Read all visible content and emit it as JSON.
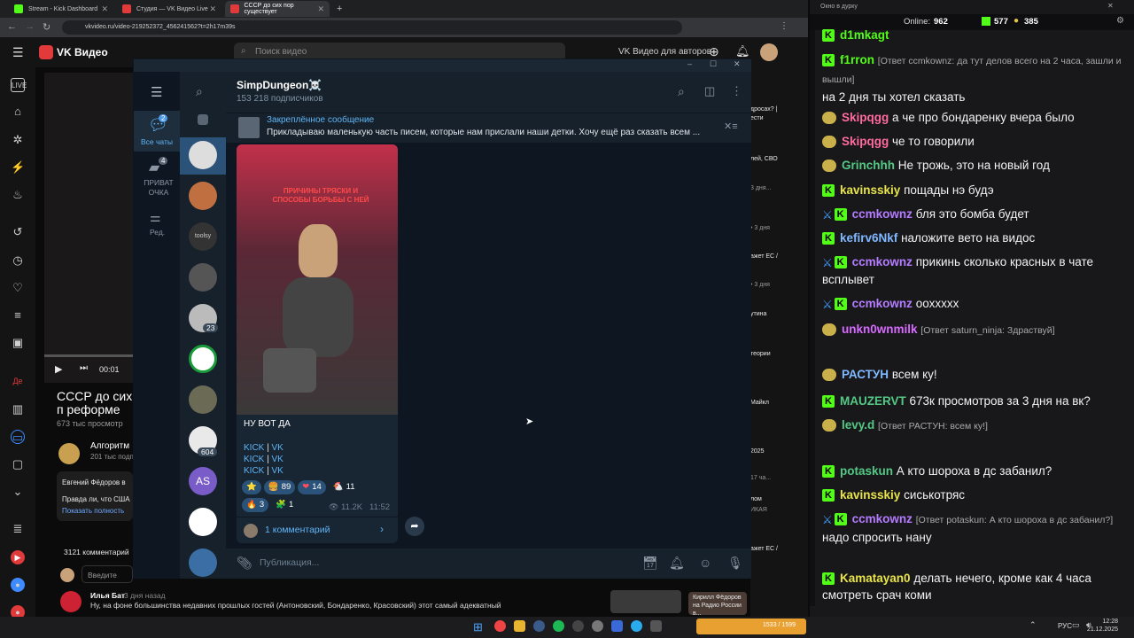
{
  "browser": {
    "tabs": [
      {
        "label": "Stream - Kick Dashboard",
        "color": "#53fc18"
      },
      {
        "label": "Студия — VK Видео Live",
        "color": "#e03a3a"
      },
      {
        "label": "СССР до сих пор существует",
        "color": "#e03a3a"
      }
    ],
    "url": "vkvideo.ru/video-219252372_456241562?t=2h17m39s",
    "new_tab": "+"
  },
  "vk": {
    "logo": "VK Видео",
    "search_placeholder": "Поиск видео",
    "for_authors": "VK Видео для авторов",
    "video_title": "СССР до сих п реформе",
    "views": "673 тыс просмотр",
    "time": "00:01",
    "channel": "Алгоритм",
    "channel_subs": "201 тыс подпис",
    "desc_author": "Евгений Фёдоров в",
    "desc_text": "Правда ли, что США",
    "show_full": "Показать полность",
    "comments_count": "3121 комментарий",
    "comment_placeholder": "Введите",
    "commenter": "Илья Бат",
    "comment_age": "3 дня назад",
    "comment_text": "Ну, на фоне большинства недавних прошлых гостей (Антоновский, Бондаренко, Красовский) этот самый адекватный",
    "right_items": [
      "дросах? |",
      "ести",
      "лей, СВО",
      "3 дня...",
      "• 3 дня",
      "ажет ЕС /",
      "• 3 дня",
      "утина",
      "теории",
      "Майкл",
      "2025",
      "17 ча...",
      "лом",
      "ИКАЯ",
      "ажет ЕС /",
      "Кирилл Фёдоров на Радио России в..."
    ]
  },
  "telegram": {
    "folders": [
      {
        "label": "Все чаты",
        "badge": "2"
      },
      {
        "label": "ПРИВАТ ОЧКА",
        "badge": "4"
      },
      {
        "label": "Ред.",
        "badge": ""
      }
    ],
    "chat_badges": [
      "23",
      "604"
    ],
    "chat_initials": "AS",
    "channel_name": "SimpDungeon☠️",
    "subscribers": "153 218 подписчиков",
    "pinned_title": "Закреплённое сообщение",
    "pinned_text": "Прикладываю маленькую часть писем, которые нам прислали наши детки.   Хочу ещё раз сказать всем ...",
    "image_caption": "ПРИЧИНЫ ТРЯСКИ И СПОСОБЫ БОРЬБЫ С НЕЙ",
    "message_text": "НУ ВОТ ДА",
    "links": [
      [
        "KICK",
        "VK"
      ],
      [
        "KICK",
        "VK"
      ],
      [
        "KICK",
        "VK"
      ]
    ],
    "reactions": [
      {
        "e": "⭐",
        "n": ""
      },
      {
        "e": "🍔",
        "n": "89"
      },
      {
        "e": "❤",
        "n": "14"
      },
      {
        "e": "🐔",
        "n": "11"
      },
      {
        "e": "🔥",
        "n": "3"
      },
      {
        "e": "🧩",
        "n": "1"
      }
    ],
    "views": "11.2K",
    "time": "11:52",
    "comments": "1 комментарий",
    "compose_placeholder": "Публикация..."
  },
  "kick": {
    "window_title": "Окно в дурку",
    "online_label": "Online:",
    "online": "962",
    "followers": "577",
    "subs": "385"
  },
  "chat": [
    {
      "nick": "d1mkagt",
      "color": "#53fc18",
      "text": "",
      "reply": ""
    },
    {
      "nick": "f1rron",
      "color": "#53fc18",
      "reply": "[Ответ ccmkownz: да тут делов всего на 2 часа, зашли и вышли]",
      "text": "на 2 дня ты хотел сказать"
    },
    {
      "nick": "Skipqgg",
      "color": "#ff6b9d",
      "reply": "",
      "text": "а че про бондаренку вчера было"
    },
    {
      "nick": "Skipqgg",
      "color": "#ff6b9d",
      "reply": "",
      "text": "че то говорили"
    },
    {
      "nick": "Grinchhh",
      "color": "#53c985",
      "reply": "",
      "text": "Не трожь, это на новый год"
    },
    {
      "nick": "kavinsskiy",
      "color": "#e9e44a",
      "reply": "",
      "text": "пощады нэ будэ"
    },
    {
      "nick": "ccmkownz",
      "color": "#b57cff",
      "reply": "",
      "text": "бля это бомба будет"
    },
    {
      "nick": "kefirv6Nkf",
      "color": "#7fb8ff",
      "reply": "",
      "text": "наложите вето на видос"
    },
    {
      "nick": "ccmkownz",
      "color": "#b57cff",
      "reply": "",
      "text": "прикинь сколько красных в чате всплывет"
    },
    {
      "nick": "ccmkownz",
      "color": "#b57cff",
      "reply": "",
      "text": "оохxxxx"
    },
    {
      "nick": "unkn0wnmilk",
      "color": "#d86bff",
      "reply": "[Ответ saturn_ninja: Здраствуй]",
      "text": ""
    },
    {
      "nick": "РАСТУН",
      "color": "#7fb8ff",
      "reply": "",
      "text": "всем ку!"
    },
    {
      "nick": "MAUZERVT",
      "color": "#53c985",
      "reply": "",
      "text": "673к просмотров за 3 дня на вк?"
    },
    {
      "nick": "levy.d",
      "color": "#53c985",
      "reply": "[Ответ РАСТУН: всем ку!]",
      "text": ""
    },
    {
      "nick": "potaskun",
      "color": "#53c985",
      "reply": "",
      "text": "А кто шороха в дс забанил?"
    },
    {
      "nick": "kavinsskiy",
      "color": "#e9e44a",
      "reply": "",
      "text": "сиськотряс"
    },
    {
      "nick": "ccmkownz",
      "color": "#b57cff",
      "reply": "[Ответ potaskun: А кто шороха в дс забанил?]",
      "text": "надо спросить нану"
    },
    {
      "nick": "Kamatayan0",
      "color": "#e9e44a",
      "reply": "",
      "text": "делать нечего, кроме как 4 часа смотреть срач коми"
    }
  ],
  "taskbar": {
    "lang": "РУС",
    "clock": "12:28",
    "date": "21.12.2025",
    "widget": "1533 / 1599"
  }
}
